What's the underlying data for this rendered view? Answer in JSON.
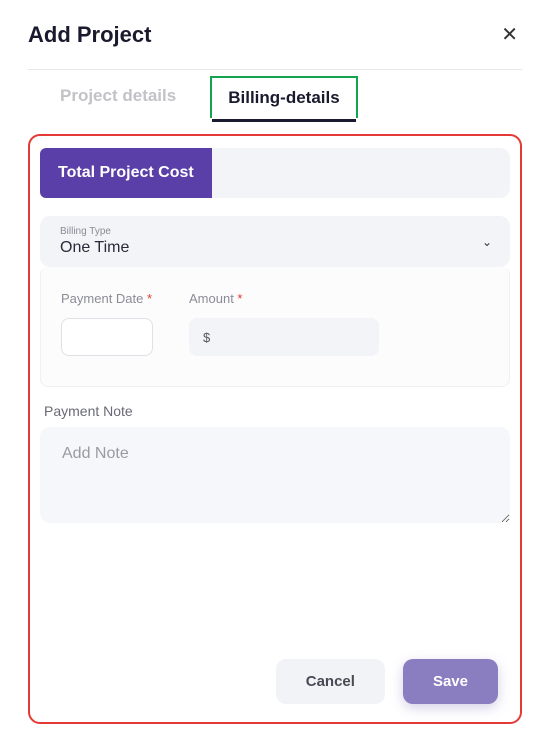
{
  "header": {
    "title": "Add Project"
  },
  "tabs": {
    "details": "Project details",
    "billing": "Billing-details"
  },
  "cost": {
    "label": "Total Project Cost"
  },
  "billing_type": {
    "label": "Billing Type",
    "value": "One Time"
  },
  "fields": {
    "payment_date_label": "Payment Date ",
    "amount_label": "Amount ",
    "amount_placeholder": "$"
  },
  "note": {
    "label": "Payment Note",
    "placeholder": "Add Note"
  },
  "actions": {
    "cancel": "Cancel",
    "save": "Save"
  }
}
